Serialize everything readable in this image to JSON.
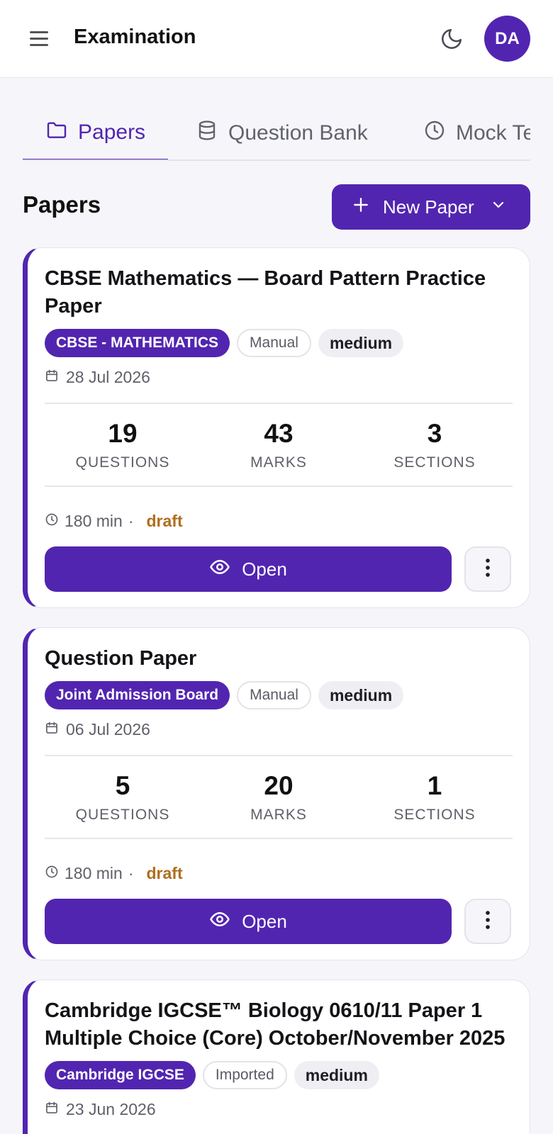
{
  "header": {
    "title": "Examination",
    "theme_icon": "moon-icon",
    "avatar_initials": "DA"
  },
  "tabs": [
    {
      "label": "Papers",
      "icon": "folder-icon",
      "active": true
    },
    {
      "label": "Question Bank",
      "icon": "database-icon",
      "active": false
    },
    {
      "label": "Mock Tests",
      "icon": "clock-icon",
      "active": false
    }
  ],
  "section": {
    "title": "Papers",
    "new_button_label": "New Paper"
  },
  "stat_labels": {
    "questions": "QUESTIONS",
    "marks": "MARKS",
    "sections": "SECTIONS"
  },
  "open_label": "Open",
  "papers": [
    {
      "title": "CBSE Mathematics — Board Pattern Practice Paper",
      "board": "CBSE - MATHEMATICS",
      "source": "Manual",
      "difficulty": "medium",
      "date": "28 Jul 2026",
      "questions": "19",
      "marks": "43",
      "sections": "3",
      "duration": "180 min",
      "status": "draft"
    },
    {
      "title": "Question Paper",
      "board": "Joint Admission Board",
      "source": "Manual",
      "difficulty": "medium",
      "date": "06 Jul 2026",
      "questions": "5",
      "marks": "20",
      "sections": "1",
      "duration": "180 min",
      "status": "draft"
    },
    {
      "title": "Cambridge IGCSE™ Biology 0610/11 Paper 1 Multiple Choice (Core) October/November 2025",
      "board": "Cambridge IGCSE",
      "source": "Imported",
      "difficulty": "medium",
      "date": "23 Jun 2026"
    }
  ],
  "colors": {
    "brand": "#5225b0",
    "status_draft": "#b06d1f",
    "background": "#f6f6fa"
  }
}
